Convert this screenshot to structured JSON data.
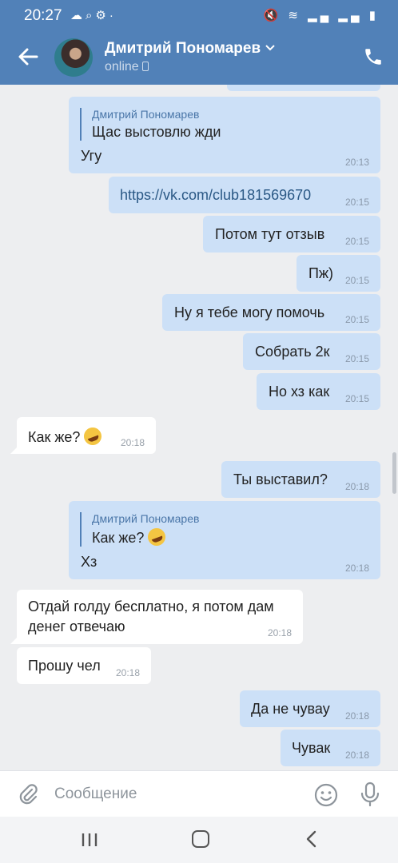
{
  "status_bar": {
    "time": "20:27",
    "left_icons": [
      "drive-icon",
      "search-icon",
      "android-icon",
      "dot-icon"
    ],
    "right_icons": [
      "mute-icon",
      "wifi-icon",
      "signal-icon",
      "signal-icon",
      "battery-icon"
    ]
  },
  "header": {
    "contact_name": "Дмитрий Пономарев",
    "status": "online",
    "icons": {
      "back": "back-arrow-icon",
      "dropdown": "chevron-down-icon",
      "call": "phone-icon"
    }
  },
  "messages": [
    {
      "dir": "out",
      "quote_author": "Дмитрий Пономарев",
      "quote_text": "Щас выстовлю жди",
      "text": "Угу",
      "time": "20:13"
    },
    {
      "dir": "out",
      "text": "https://vk.com/club181569670",
      "time": "20:15",
      "is_link": true
    },
    {
      "dir": "out",
      "text": "Потом тут отзыв",
      "time": "20:15"
    },
    {
      "dir": "out",
      "text": "Пж)",
      "time": "20:15"
    },
    {
      "dir": "out",
      "text": "Ну я тебе могу помочь",
      "time": "20:15"
    },
    {
      "dir": "out",
      "text": "Собрать 2к",
      "time": "20:15"
    },
    {
      "dir": "out",
      "text": "Но хз как",
      "time": "20:15"
    },
    {
      "dir": "in",
      "text": "Как же?",
      "emoji": "rofl-emoji",
      "time": "20:18"
    },
    {
      "dir": "out",
      "text": "Ты выставил?",
      "time": "20:18"
    },
    {
      "dir": "out",
      "quote_author": "Дмитрий Пономарев",
      "quote_text": "Как же?",
      "quote_emoji": "rofl-emoji",
      "text": "Хз",
      "time": "20:18"
    },
    {
      "dir": "in",
      "text_line1": "Отдай голду бесплатно, я потом дам",
      "text_line2": "денег отвечаю",
      "time": "20:18"
    },
    {
      "dir": "in",
      "text": "Прошу чел",
      "time": "20:18"
    },
    {
      "dir": "out",
      "text": "Да не чувау",
      "time": "20:18"
    },
    {
      "dir": "out",
      "text": "Чувак",
      "time": "20:18"
    }
  ],
  "composer": {
    "placeholder": "Сообщение",
    "icons": {
      "attach": "paperclip-icon",
      "emoji": "smiley-icon",
      "voice": "microphone-icon"
    }
  },
  "nav": {
    "icons": [
      "recent-apps-icon",
      "home-icon",
      "back-icon"
    ]
  }
}
